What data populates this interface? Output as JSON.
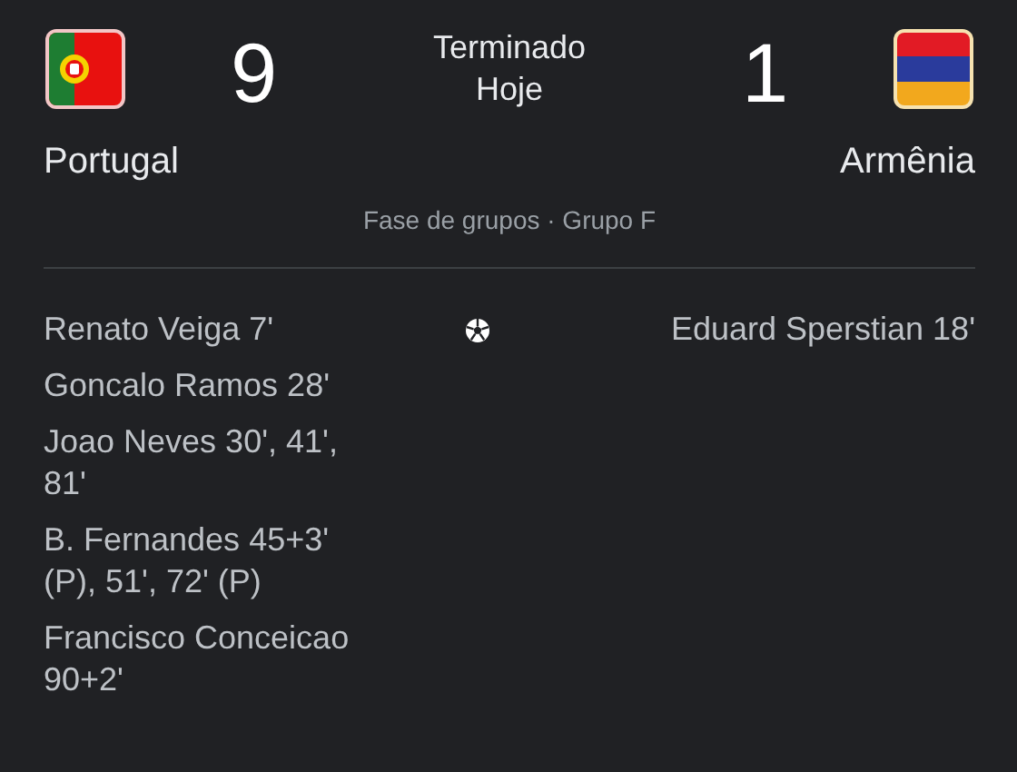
{
  "home": {
    "name": "Portugal",
    "score": "9"
  },
  "away": {
    "name": "Armênia",
    "score": "1"
  },
  "status": {
    "state": "Terminado",
    "day": "Hoje"
  },
  "stage": "Fase de grupos · Grupo F",
  "home_scorers": [
    "Renato Veiga 7'",
    "Goncalo Ramos 28'",
    "Joao Neves 30', 41', 81'",
    "B. Fernandes 45+3' (P), 51', 72' (P)",
    "Francisco Conceicao 90+2'"
  ],
  "away_scorers": [
    "Eduard Sperstian 18'"
  ]
}
